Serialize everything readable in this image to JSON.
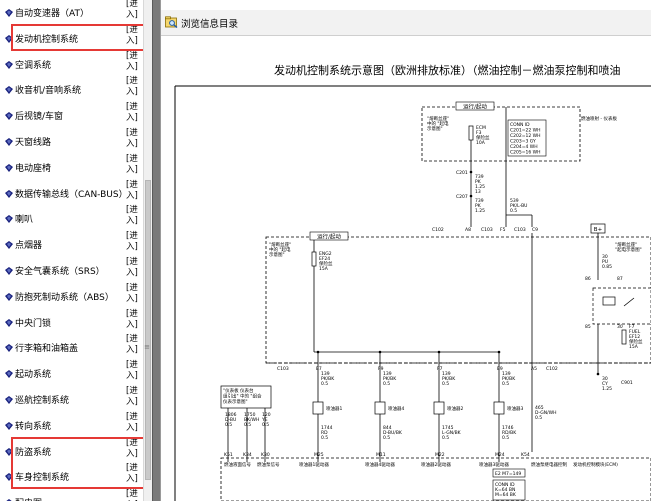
{
  "sidebar": {
    "enter_label": "[进入]",
    "enter_open": "[进",
    "enter_close": "入]",
    "items": [
      {
        "label": "自动变速器（AT）",
        "highlighted": false
      },
      {
        "label": "发动机控制系统",
        "highlighted": true
      },
      {
        "label": "空调系统",
        "highlighted": false
      },
      {
        "label": "收音机/音响系统",
        "highlighted": false
      },
      {
        "label": "后视镜/车窗",
        "highlighted": false
      },
      {
        "label": "天窗线路",
        "highlighted": false
      },
      {
        "label": "电动座椅",
        "highlighted": false
      },
      {
        "label": "数据传输总线（CAN-BUS）",
        "highlighted": false
      },
      {
        "label": "喇叭",
        "highlighted": false
      },
      {
        "label": "点烟器",
        "highlighted": false
      },
      {
        "label": "安全气囊系统（SRS）",
        "highlighted": false
      },
      {
        "label": "防抱死制动系统（ABS）",
        "highlighted": false
      },
      {
        "label": "中央门锁",
        "highlighted": false
      },
      {
        "label": "行李箱和油箱盖",
        "highlighted": false
      },
      {
        "label": "起动系统",
        "highlighted": false
      },
      {
        "label": "巡航控制系统",
        "highlighted": false
      },
      {
        "label": "转向系统",
        "highlighted": false
      },
      {
        "label": "防盗系统",
        "highlighted": true
      },
      {
        "label": "车身控制系统",
        "highlighted": true
      },
      {
        "label": "配电图",
        "highlighted": false
      }
    ]
  },
  "toolbar": {
    "browse_label": "浏览信息目录",
    "icon": "browse-folder-icon"
  },
  "document": {
    "title": "发动机控制系统示意图（欧洲排放标准）（燃油控制－燃油泵控制和喷油"
  },
  "diagram": {
    "top_tag": "运行/起动",
    "left_tag": "运行/起动",
    "batt_tag": "B+",
    "note_top": [
      "\"熔断丝座\"",
      "中的 \"起电",
      "示意图\""
    ],
    "note_left": [
      "\"熔断丝座\"",
      "中的 \"起电",
      "示意图\""
    ],
    "note_right": [
      "\"熔断丝座\"",
      "\"起电示意图\""
    ],
    "note_bottom": [
      "\"仪表板  仪表台",
      "组引出\" 中的 \"组合",
      "仪表示意图\""
    ],
    "conn_id_title": "CONN ID",
    "conn_id_lines": [
      "C201=22 WH",
      "C202=12 WH",
      "C203=3 GY",
      "C204=4 WH",
      "C205=16 WH"
    ],
    "fuse_top": [
      "ECM",
      "F3",
      "保险丝",
      "10A"
    ],
    "fuse_left": [
      "ENG2",
      "EF24",
      "保险丝",
      "15A"
    ],
    "fuse_right": [
      "F7",
      "FUEL",
      "EF12",
      "保险丝",
      "15A"
    ],
    "wire_labels": {
      "w1": [
        "739",
        "PK",
        "1.25",
        "13"
      ],
      "w2": [
        "739",
        "PK",
        "1.25"
      ],
      "w3": [
        "539",
        "PK/L-BU",
        "0.5"
      ],
      "w4": [
        "30",
        "PU",
        "0.85"
      ],
      "w_relay": [
        "30",
        "CY",
        "1.25"
      ],
      "w_465": [
        "465",
        "D-GN/WH",
        "0.5"
      ]
    },
    "connectors": {
      "c201": "C201",
      "c207": "C207",
      "c102": "C102",
      "a8": "A8",
      "c103a": "C103",
      "f5": "F5",
      "c103b": "C103",
      "c9": "C9",
      "c103c": "C103",
      "a5": "A5",
      "c102b": "C102",
      "86": "86",
      "85": "85",
      "87": "87",
      "30": "30"
    },
    "injector_pins": [
      {
        "pin": "E7",
        "wire": [
          "139",
          "PK/BK",
          "0.5"
        ],
        "label": "喷油器1",
        "out": [
          "1744",
          "RD",
          "0.5"
        ],
        "conn": "M25"
      },
      {
        "pin": "F9",
        "wire": [
          "139",
          "PK/BK",
          "0.5"
        ],
        "label": "喷油器4",
        "out": [
          "844",
          "D-BU/BK",
          "0.5"
        ],
        "conn": "M11"
      },
      {
        "pin": "F7",
        "wire": [
          "139",
          "PK/BK",
          "0.5"
        ],
        "label": "喷油器2",
        "out": [
          "1745",
          "L-GN/BK",
          "0.5"
        ],
        "conn": "M22"
      },
      {
        "pin": "E9",
        "wire": [
          "139",
          "PK/BK",
          "0.5"
        ],
        "label": "喷油器3",
        "out": [
          "1746",
          "RD/BK",
          "0.5"
        ],
        "conn": "M24"
      }
    ],
    "bottom_left_wires": [
      {
        "wire": [
          "1806",
          "D-BU",
          "0.5"
        ],
        "conn": "K51"
      },
      {
        "wire": [
          "1750",
          "BK/WH",
          "0.5"
        ],
        "conn": "K34"
      },
      {
        "wire": [
          "120",
          "YE",
          "0.5"
        ],
        "conn": "K30"
      }
    ],
    "bottom_labels": [
      "燃油液面信号",
      "燃油泵信号",
      "喷油器1驱动器",
      "喷油器4驱动器",
      "喷油器2驱动器",
      "喷油器3驱动器",
      "燃油泵继电器控制",
      "发动机控制模块(ECM)"
    ],
    "k54": "K54",
    "bottom_conn_id": [
      "CONN ID",
      "K=64 BN",
      "M=64 BK"
    ],
    "e2_label": "E2 M7=149",
    "c501": "C901",
    "fuel_relay_label": "燃油泵继电器",
    "top_right_note": "燃油喷射 - 仪表板"
  }
}
